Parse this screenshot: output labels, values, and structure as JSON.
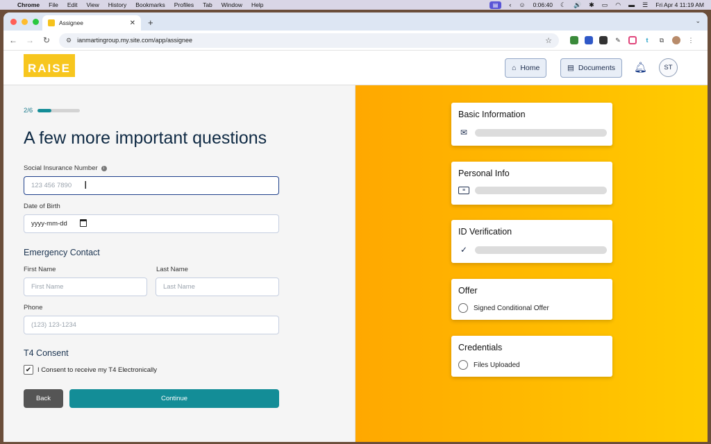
{
  "menubar": {
    "apple": "",
    "items": [
      "Chrome",
      "File",
      "Edit",
      "View",
      "History",
      "Bookmarks",
      "Profiles",
      "Tab",
      "Window",
      "Help"
    ],
    "timer": "0:06:40",
    "datetime": "Fri Apr 4  11:19 AM"
  },
  "browser": {
    "tab_title": "Assignee",
    "url": "ianmartingroup.my.site.com/app/assignee"
  },
  "header": {
    "logo": "RAISE",
    "home_label": "Home",
    "documents_label": "Documents",
    "avatar_initials": "ST"
  },
  "progress": {
    "text": "2/6",
    "fraction": 0.33
  },
  "form": {
    "title": "A few more important questions",
    "sin_label": "Social Insurance Number",
    "sin_placeholder": "123 456 7890",
    "dob_label": "Date of Birth",
    "dob_placeholder": "yyyy-mm-dd",
    "emergency_title": "Emergency Contact",
    "first_name_label": "First Name",
    "first_name_placeholder": "First Name",
    "last_name_label": "Last Name",
    "last_name_placeholder": "Last Name",
    "phone_label": "Phone",
    "phone_placeholder": "(123) 123-1234",
    "t4_title": "T4 Consent",
    "t4_checked": true,
    "t4_text": "I Consent to receive my T4 Electronically",
    "back_label": "Back",
    "continue_label": "Continue"
  },
  "cards": {
    "basic": {
      "title": "Basic Information",
      "icon": "envelope-icon"
    },
    "personal": {
      "title": "Personal Info",
      "icon": "id-card-icon"
    },
    "id": {
      "title": "ID Verification",
      "icon": "check-circle-icon"
    },
    "offer": {
      "title": "Offer",
      "item": "Signed Conditional Offer"
    },
    "credentials": {
      "title": "Credentials",
      "item": "Files Uploaded"
    }
  },
  "colors": {
    "accent": "#138d97",
    "navy": "#1d3f8a",
    "brand_yellow": "#f7c61e",
    "panel_orange": "#ffb000"
  }
}
